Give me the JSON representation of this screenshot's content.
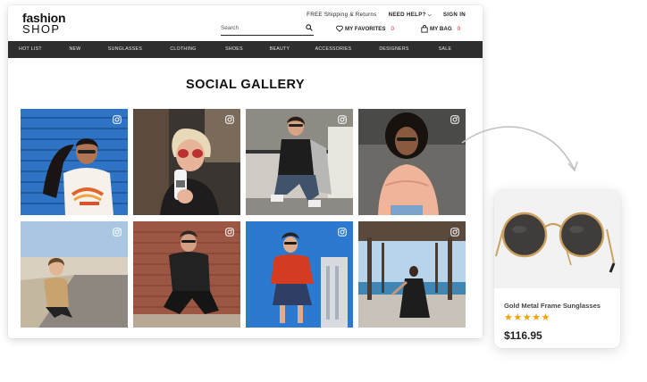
{
  "header": {
    "logo_line1": "fashion",
    "logo_line2": "SHOP",
    "shipping_label": "FREE Shipping & Returns",
    "help_label": "NEED HELP?",
    "signin_label": "SIGN IN",
    "search_placeholder": "Search",
    "favorites_label": "MY FAVORITES",
    "favorites_count": "0",
    "bag_label": "MY BAG",
    "bag_count": "0"
  },
  "nav": {
    "items": [
      "HOT LIST",
      "NEW",
      "SUNGLASSES",
      "CLOTHING",
      "SHOES",
      "BEAUTY",
      "ACCESSORIES",
      "DESIGNERS",
      "SALE"
    ]
  },
  "gallery": {
    "title": "SOCIAL GALLERY",
    "tile_count": 8
  },
  "product": {
    "name": "Gold Metal Frame Sunglasses",
    "stars": "★★★★★",
    "rating": 5,
    "price": "$116.95"
  },
  "colors": {
    "nav_bg": "#2e2e2e",
    "count_red": "#e0202c",
    "star_orange": "#f2a20f"
  },
  "icons": [
    "search-icon",
    "heart-icon",
    "bag-icon",
    "instagram-icon",
    "chevron-down-icon",
    "curved-arrow-icon"
  ]
}
